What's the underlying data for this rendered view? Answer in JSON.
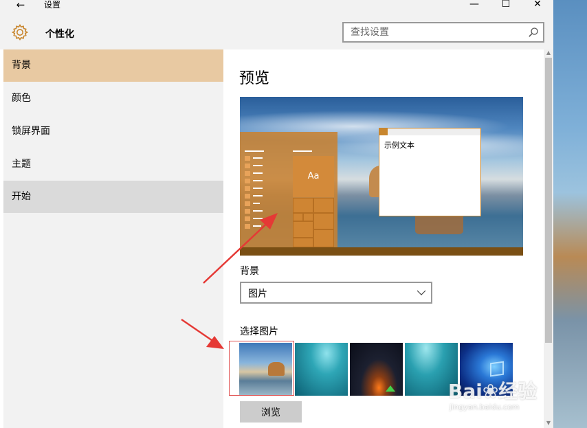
{
  "window": {
    "title": "设置",
    "back_icon": "←",
    "minimize_icon": "—",
    "maximize_icon": "☐",
    "close_icon": "✕"
  },
  "header": {
    "title": "个性化",
    "icon": "gear-icon",
    "search_placeholder": "查找设置"
  },
  "sidebar": {
    "items": [
      {
        "label": "背景",
        "state": "selected"
      },
      {
        "label": "颜色",
        "state": "normal"
      },
      {
        "label": "锁屏界面",
        "state": "normal"
      },
      {
        "label": "主题",
        "state": "normal"
      },
      {
        "label": "开始",
        "state": "hover"
      }
    ]
  },
  "content": {
    "preview_title": "预览",
    "preview": {
      "tile_label": "Aa",
      "sample_text": "示例文本"
    },
    "background_label": "背景",
    "background_select_value": "图片",
    "choose_picture_label": "选择图片",
    "thumbnails_count": 5,
    "selected_thumbnail": 1,
    "browse_label": "浏览"
  },
  "colors": {
    "accent": "#c8862e",
    "sidebar_selected": "#e8c9a2",
    "sidebar_hover": "#dadada",
    "annotation": "#e53935"
  },
  "watermark": {
    "logo": "Bai❀经验",
    "url": "jingyan.baidu.com"
  }
}
